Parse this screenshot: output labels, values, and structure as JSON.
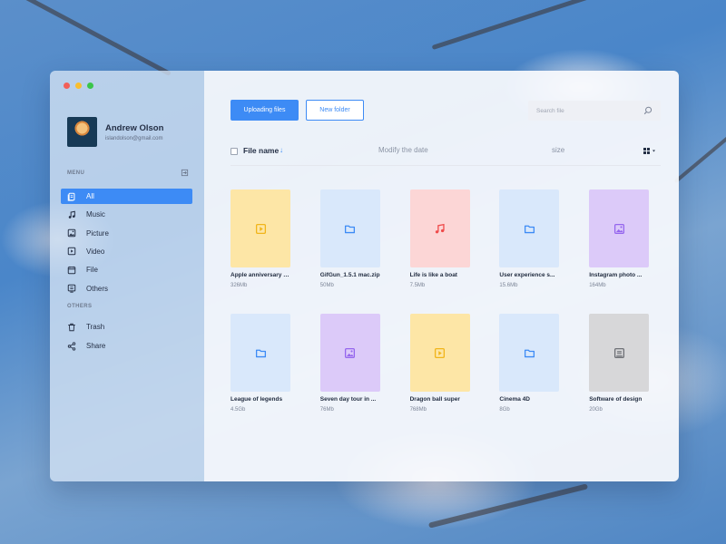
{
  "window_controls": {
    "colors": [
      "#f25f58",
      "#f9be2e",
      "#3ac54a"
    ]
  },
  "user": {
    "name": "Andrew Olson",
    "email": "islandolson@gmail.com"
  },
  "sidebar": {
    "menu_label": "MENU",
    "others_label": "OTHERS",
    "items": [
      {
        "label": "All",
        "icon": "all-files-icon",
        "active": true
      },
      {
        "label": "Music",
        "icon": "music-note-icon"
      },
      {
        "label": "Picture",
        "icon": "picture-icon"
      },
      {
        "label": "Video",
        "icon": "video-icon"
      },
      {
        "label": "File",
        "icon": "file-icon"
      },
      {
        "label": "Others",
        "icon": "others-icon"
      }
    ],
    "other_items": [
      {
        "label": "Trash",
        "icon": "trash-icon"
      },
      {
        "label": "Share",
        "icon": "share-icon"
      }
    ]
  },
  "toolbar": {
    "upload_label": "Uploading files",
    "new_folder_label": "New folder"
  },
  "search": {
    "placeholder": "Search file",
    "value": ""
  },
  "columns": {
    "name": "File name",
    "sort_indicator": "↓",
    "date": "Modify the date",
    "size": "size"
  },
  "colors": {
    "accent": "#3d8bf5"
  },
  "files": [
    {
      "name": "Apple anniversary c...",
      "size": "326Mb",
      "type": "video",
      "bg": "#fde6a6",
      "fg": "#f1b51a"
    },
    {
      "name": "GifGun_1.5.1 mac.zip",
      "size": "50Mb",
      "type": "folder",
      "bg": "#d9e8fb",
      "fg": "#3d8bf5"
    },
    {
      "name": "Life is like a boat",
      "size": "7.5Mb",
      "type": "music",
      "bg": "#fcd6d6",
      "fg": "#ef4b4b"
    },
    {
      "name": "User experience s...",
      "size": "15.6Mb",
      "type": "folder",
      "bg": "#d9e8fb",
      "fg": "#3d8bf5"
    },
    {
      "name": "Instagram photo ...",
      "size": "164Mb",
      "type": "picture",
      "bg": "#dccaf9",
      "fg": "#9566ee"
    },
    {
      "name": "League of legends",
      "size": "4.5Gb",
      "type": "folder",
      "bg": "#d9e8fb",
      "fg": "#3d8bf5"
    },
    {
      "name": "Seven day tour in ...",
      "size": "76Mb",
      "type": "picture",
      "bg": "#dccaf9",
      "fg": "#9566ee"
    },
    {
      "name": "Dragon ball super",
      "size": "768Mb",
      "type": "video",
      "bg": "#fde6a6",
      "fg": "#f1b51a"
    },
    {
      "name": "Cinema 4D",
      "size": "8Gb",
      "type": "folder",
      "bg": "#d9e8fb",
      "fg": "#3d8bf5"
    },
    {
      "name": "Software of design",
      "size": "20Gb",
      "type": "document",
      "bg": "#d7d7d9",
      "fg": "#6e7076"
    }
  ]
}
